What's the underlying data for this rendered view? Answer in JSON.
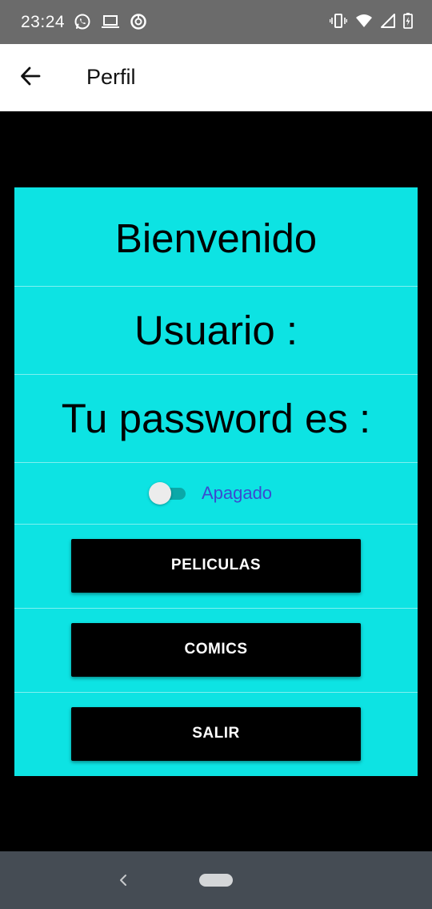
{
  "status_bar": {
    "time": "23:24",
    "left_icons": [
      "whatsapp-icon",
      "laptop-icon",
      "data-saver-icon"
    ],
    "right_icons": [
      "vibrate-icon",
      "wifi-icon",
      "signal-icon",
      "battery-charging-icon"
    ]
  },
  "app_bar": {
    "title": "Perfil",
    "back_icon": "arrow-back-icon"
  },
  "profile": {
    "welcome": "Bienvenido",
    "user_label": "Usuario :",
    "password_label": "Tu password es :",
    "switch_label": "Apagado",
    "switch_on": false
  },
  "buttons": {
    "movies": "PELICULAS",
    "comics": "COMICS",
    "logout": "SALIR"
  },
  "colors": {
    "card_background": "#0de3e3",
    "content_background": "#000000",
    "switch_label": "#3b4ad0",
    "button_background": "#000000"
  },
  "nav_bar": {
    "back_icon": "chevron-left-icon",
    "home_icon": "home-pill-icon"
  }
}
